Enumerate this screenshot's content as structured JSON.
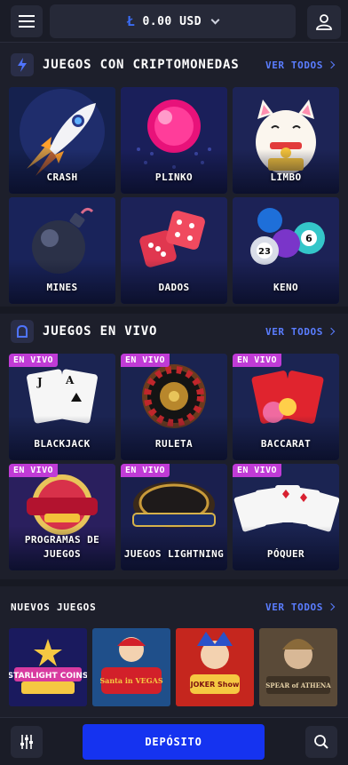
{
  "header": {
    "balance": "0.00 USD",
    "currency_symbol": "Ł",
    "icons": [
      "menu-icon",
      "litecoin-icon",
      "chevron-down-icon",
      "user-icon"
    ]
  },
  "crypto": {
    "title": "JUEGOS CON CRIPTOMONEDAS",
    "see_all": "VER TODOS",
    "games": [
      {
        "label": "CRASH"
      },
      {
        "label": "PLINKO"
      },
      {
        "label": "LIMBO"
      },
      {
        "label": "MINES"
      },
      {
        "label": "DADOS"
      },
      {
        "label": "KENO"
      }
    ]
  },
  "live": {
    "title": "JUEGOS EN VIVO",
    "see_all": "VER TODOS",
    "badge": "EN VIVO",
    "games": [
      {
        "label": "BLACKJACK"
      },
      {
        "label": "RULETA"
      },
      {
        "label": "BACCARAT"
      },
      {
        "label": "PROGRAMAS DE JUEGOS"
      },
      {
        "label": "JUEGOS LIGHTNING"
      },
      {
        "label": "PÓQUER"
      }
    ]
  },
  "new_games": {
    "title": "NUEVOS JUEGOS",
    "see_all": "VER TODOS",
    "tiles": [
      {
        "logo": "STARLIGHT COINS"
      },
      {
        "logo": "Santa in VEGAS"
      },
      {
        "logo": "JOKER Show"
      },
      {
        "logo": "SPEAR of ATHENA"
      }
    ]
  },
  "footer": {
    "deposit": "DEPÓSITO",
    "icons": [
      "sliders-icon",
      "search-icon"
    ]
  },
  "colors": {
    "accent": "#1533f0",
    "link": "#5a7dff",
    "live_badge": "#c03bd6",
    "background": "#1d1f2b"
  }
}
